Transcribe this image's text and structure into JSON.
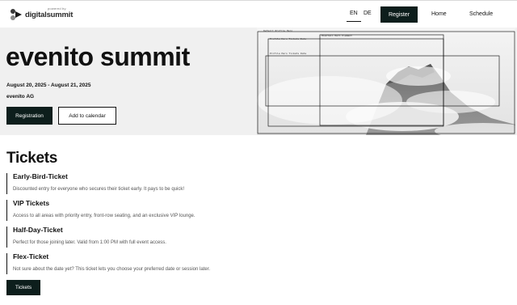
{
  "header": {
    "logo": {
      "small_text": "powered by",
      "brand_text": "digitalsummit"
    },
    "languages": [
      {
        "label": "EN",
        "active": true
      },
      {
        "label": "DE",
        "active": false
      }
    ],
    "register_label": "Register",
    "nav": [
      {
        "label": "Home"
      },
      {
        "label": "Schedule"
      }
    ]
  },
  "hero": {
    "title": "evenito summit",
    "dates": "August 20, 2025 - August 21, 2025",
    "organizer": "evenito AG",
    "registration_label": "Registration",
    "calendar_label": "Add to calendar",
    "image_overlay_labels": [
      "Default Profile Hero",
      "Mountain Hero Element",
      "Profile Hero Tickets Data",
      "Profile Hero Tickets Data"
    ]
  },
  "tickets": {
    "title": "Tickets",
    "items": [
      {
        "name": "Early-Bird-Ticket",
        "description": "Discounted entry for everyone who secures their ticket early. It pays to be quick!"
      },
      {
        "name": "VIP Tickets",
        "description": "Access to all areas with priority entry, front-row seating, and an exclusive VIP lounge."
      },
      {
        "name": "Half-Day-Ticket",
        "description": "Perfect for those joining later. Valid from 1:00 PM with full event access."
      },
      {
        "name": "Flex-Ticket",
        "description": "Not sure about the date yet? This ticket lets you choose your preferred date or session later."
      }
    ],
    "button_label": "Tickets"
  },
  "colors": {
    "primary_dark": "#0d1e1c",
    "hero_background": "#f0f0f0"
  }
}
